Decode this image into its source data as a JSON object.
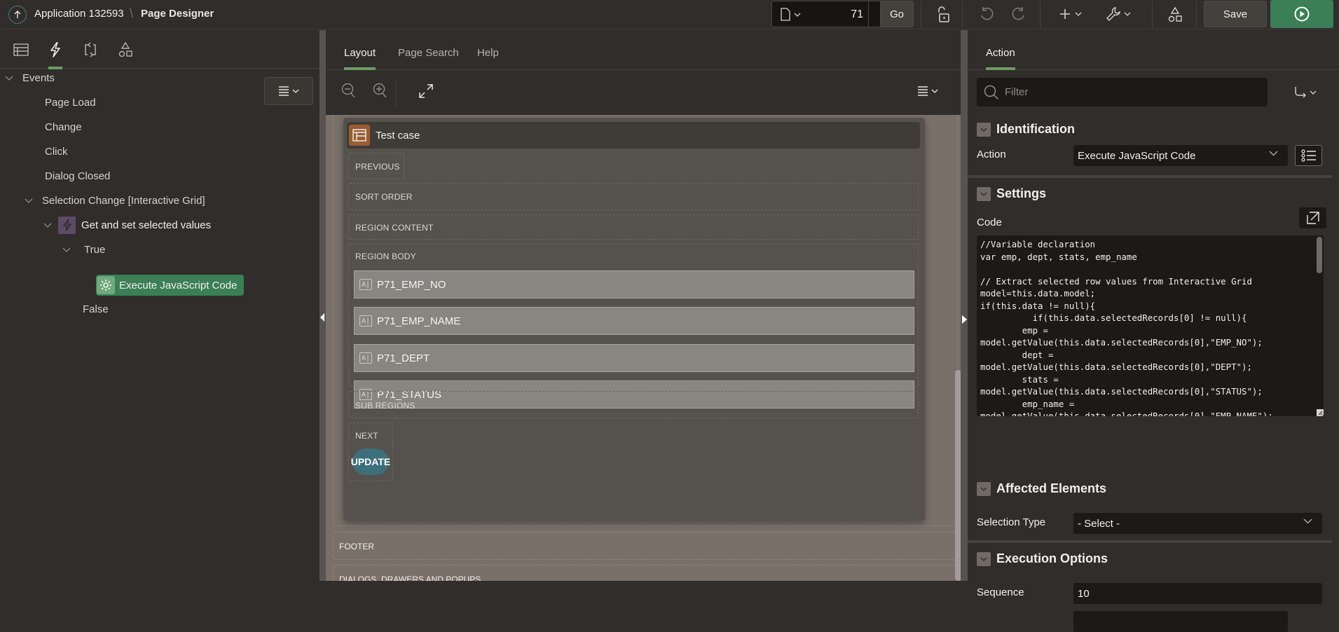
{
  "header": {
    "app_label": "Application 132593",
    "separator": "\\",
    "page_label": "Page Designer",
    "page_number": "71",
    "go_label": "Go",
    "save_label": "Save",
    "icons": [
      "up-arrow-icon",
      "page-icon",
      "lock-icon",
      "undo-icon",
      "redo-icon",
      "add-icon",
      "wrench-icon",
      "shared-components-icon",
      "run-icon"
    ]
  },
  "left": {
    "tabs": [
      {
        "name": "rendering",
        "icon": "rendering-icon",
        "active": false
      },
      {
        "name": "dynamic-actions",
        "icon": "lightning-icon",
        "active": true
      },
      {
        "name": "processing",
        "icon": "processing-icon",
        "active": false
      },
      {
        "name": "shared-components",
        "icon": "shapes-icon",
        "active": false
      }
    ],
    "tree": {
      "root": "Events",
      "events": [
        "Page Load",
        "Change",
        "Click",
        "Dialog Closed"
      ],
      "selection_change": "Selection Change [Interactive Grid]",
      "dynamic_action": "Get and set selected values",
      "true_branch": "True",
      "selected_action": "Execute JavaScript Code",
      "false_branch": "False"
    }
  },
  "center": {
    "tabs": [
      {
        "label": "Layout",
        "active": true
      },
      {
        "label": "Page Search",
        "active": false
      },
      {
        "label": "Help",
        "active": false
      }
    ],
    "region": {
      "title": "Test case",
      "previous": "PREVIOUS",
      "sort_order": "SORT ORDER",
      "region_content": "REGION CONTENT",
      "region_body": "REGION BODY",
      "items": [
        "P71_EMP_NO",
        "P71_EMP_NAME",
        "P71_DEPT",
        "P71_STATUS"
      ],
      "item_badge": "A|",
      "sub_regions": "SUB REGIONS",
      "next": "NEXT",
      "button": "UPDATE"
    },
    "page_slots": [
      "FOOTER",
      "DIALOGS, DRAWERS AND POPUPS"
    ]
  },
  "right": {
    "tab": "Action",
    "filter_placeholder": "Filter",
    "groups": {
      "identification": {
        "title": "Identification",
        "action_label": "Action",
        "action_value": "Execute JavaScript Code"
      },
      "settings": {
        "title": "Settings",
        "code_label": "Code",
        "code": "//Variable declaration\nvar emp, dept, stats, emp_name\n\n// Extract selected row values from Interactive Grid\nmodel=this.data.model;\nif(this.data != null){\n          if(this.data.selectedRecords[0] != null){\n        emp =\nmodel.getValue(this.data.selectedRecords[0],\"EMP_NO\");\n        dept =\nmodel.getValue(this.data.selectedRecords[0],\"DEPT\");\n        stats =\nmodel.getValue(this.data.selectedRecords[0],\"STATUS\");\n        emp_name =\nmodel.getValue(this.data.selectedRecords[0],\"EMP_NAME\");"
      },
      "affected": {
        "title": "Affected Elements",
        "selection_type_label": "Selection Type",
        "selection_type_value": "- Select -"
      },
      "execution": {
        "title": "Execution Options",
        "sequence_label": "Sequence",
        "sequence_value": "10"
      }
    }
  },
  "colors": {
    "accent_green": "#3a7f56",
    "tab_indicator": "#6e9a66",
    "update_button": "#3d6f7b",
    "dynamic_action_icon": "#5d4a66",
    "region_icon": "#9a5c34"
  }
}
